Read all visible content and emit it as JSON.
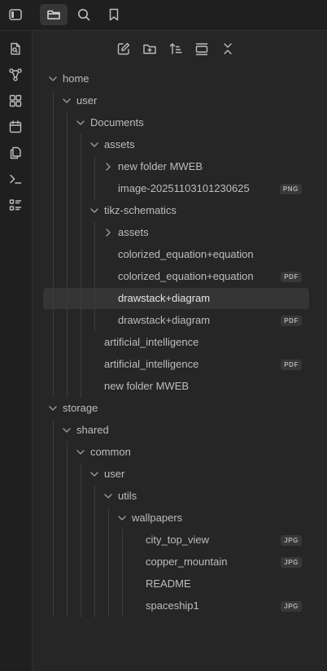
{
  "topbar": {
    "buttons": [
      {
        "icon": "sidebar-toggle-icon",
        "active": false
      },
      {
        "icon": "folder-icon",
        "active": true
      },
      {
        "icon": "search-icon",
        "active": false
      },
      {
        "icon": "bookmark-icon",
        "active": false
      }
    ]
  },
  "ribbon": {
    "buttons": [
      {
        "icon": "file-search-icon"
      },
      {
        "icon": "graph-icon"
      },
      {
        "icon": "grid-layout-icon"
      },
      {
        "icon": "calendar-icon"
      },
      {
        "icon": "copy-files-icon"
      },
      {
        "icon": "terminal-icon"
      },
      {
        "icon": "checklist-icon"
      }
    ]
  },
  "explorer": {
    "toolbar": [
      {
        "icon": "new-note-icon"
      },
      {
        "icon": "new-folder-icon"
      },
      {
        "icon": "sort-icon"
      },
      {
        "icon": "auto-reveal-icon"
      },
      {
        "icon": "collapse-all-icon"
      }
    ],
    "tree": [
      {
        "label": "home",
        "depth": 0,
        "chevron": "down"
      },
      {
        "label": "user",
        "depth": 1,
        "chevron": "down"
      },
      {
        "label": "Documents",
        "depth": 2,
        "chevron": "down"
      },
      {
        "label": "assets",
        "depth": 3,
        "chevron": "down"
      },
      {
        "label": "new folder MWEB",
        "depth": 4,
        "chevron": "right"
      },
      {
        "label": "image-20251103101230625",
        "depth": 4,
        "badge": "PNG"
      },
      {
        "label": "tikz-schematics",
        "depth": 3,
        "chevron": "down"
      },
      {
        "label": "assets",
        "depth": 4,
        "chevron": "right"
      },
      {
        "label": "colorized_equation+equation",
        "depth": 4
      },
      {
        "label": "colorized_equation+equation",
        "depth": 4,
        "badge": "PDF"
      },
      {
        "label": "drawstack+diagram",
        "depth": 4,
        "selected": true
      },
      {
        "label": "drawstack+diagram",
        "depth": 4,
        "badge": "PDF"
      },
      {
        "label": "artificial_intelligence",
        "depth": 3
      },
      {
        "label": "artificial_intelligence",
        "depth": 3,
        "badge": "PDF"
      },
      {
        "label": "new folder MWEB",
        "depth": 3
      },
      {
        "label": "storage",
        "depth": 0,
        "chevron": "down"
      },
      {
        "label": "shared",
        "depth": 1,
        "chevron": "down"
      },
      {
        "label": "common",
        "depth": 2,
        "chevron": "down"
      },
      {
        "label": "user",
        "depth": 3,
        "chevron": "down"
      },
      {
        "label": "utils",
        "depth": 4,
        "chevron": "down"
      },
      {
        "label": "wallpapers",
        "depth": 5,
        "chevron": "down"
      },
      {
        "label": "city_top_view",
        "depth": 6,
        "badge": "JPG"
      },
      {
        "label": "copper_mountain",
        "depth": 6,
        "badge": "JPG"
      },
      {
        "label": "README",
        "depth": 6
      },
      {
        "label": "spaceship1",
        "depth": 6,
        "badge": "JPG"
      }
    ]
  }
}
